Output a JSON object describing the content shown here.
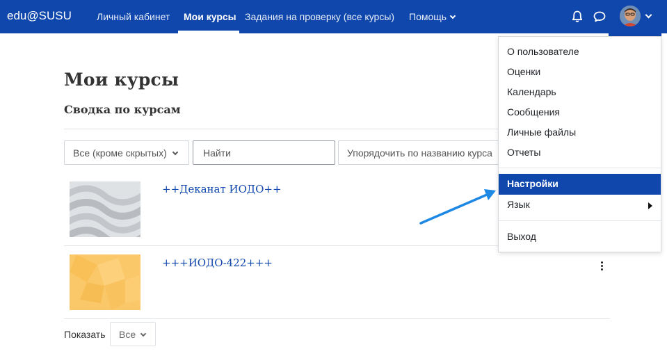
{
  "navbar": {
    "brand": "edu@SUSU",
    "links": [
      "Личный кабинет",
      "Мои курсы",
      "Задания на проверку (все курсы)",
      "Помощь"
    ],
    "active_link": "Мои курсы",
    "icons": [
      "bell-icon",
      "chat-bubble-icon",
      "user-avatar",
      "chevron-down-icon"
    ],
    "bg_color": "#0f47ad"
  },
  "page": {
    "title": "Мои курсы",
    "section_title": "Сводка по курсам"
  },
  "filters": {
    "grouping": "Все (кроме скрытых)",
    "search_placeholder": "Найти",
    "sort": "Упорядочить по названию курса"
  },
  "courses": [
    {
      "name": "++Деканат ИОДО++",
      "image": "gray-wave-pattern"
    },
    {
      "name": "+++ИОДО-422+++",
      "image": "yellow-geometric-pattern"
    }
  ],
  "paging": {
    "show_label": "Показать",
    "show_value": "Все"
  },
  "user_menu": {
    "items": [
      {
        "label": "О пользователе"
      },
      {
        "label": "Оценки"
      },
      {
        "label": "Календарь"
      },
      {
        "label": "Сообщения"
      },
      {
        "label": "Личные файлы"
      },
      {
        "label": "Отчеты"
      },
      {
        "label": "Настройки",
        "active": true
      },
      {
        "label": "Язык",
        "submenu": true
      },
      {
        "label": "Выход"
      }
    ]
  },
  "annotation": {
    "arrow_color": "#1e88e5",
    "points_to": "Настройки"
  }
}
